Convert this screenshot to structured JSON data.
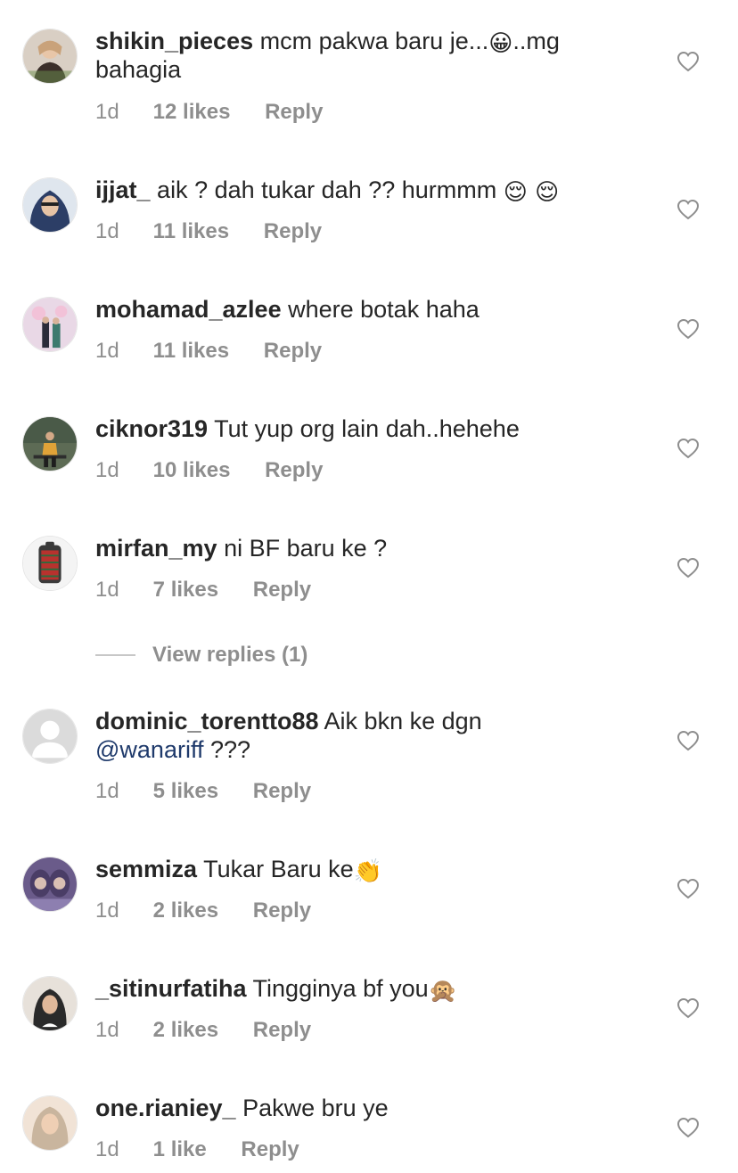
{
  "comments": [
    {
      "username": "shikin_pieces",
      "text_before": "mcm pakwa baru je...",
      "emoji": "😀",
      "text_after": "..mg bahagia",
      "time": "1d",
      "likes": "12 likes",
      "reply": "Reply"
    },
    {
      "username": "ijjat_",
      "text_before": "aik ? dah tukar dah ?? hurmmm ",
      "emoji": "😌 😌",
      "time": "1d",
      "likes": "11 likes",
      "reply": "Reply"
    },
    {
      "username": "mohamad_azlee",
      "text_before": "where botak haha",
      "time": "1d",
      "likes": "11 likes",
      "reply": "Reply"
    },
    {
      "username": "ciknor319",
      "text_before": "Tut yup org lain dah..hehehe",
      "time": "1d",
      "likes": "10 likes",
      "reply": "Reply"
    },
    {
      "username": "mirfan_my",
      "text_before": "ni BF baru ke ?",
      "time": "1d",
      "likes": "7 likes",
      "reply": "Reply"
    },
    {
      "username": "dominic_torentto88",
      "text_before": "Aik bkn ke dgn",
      "mention": "@wanariff",
      "text_after": " ???",
      "time": "1d",
      "likes": "5 likes",
      "reply": "Reply"
    },
    {
      "username": "semmiza",
      "text_before": "Tukar Baru ke",
      "emoji": "👏",
      "time": "1d",
      "likes": "2 likes",
      "reply": "Reply"
    },
    {
      "username": "_sitinurfatiha",
      "text_before": "Tingginya bf you",
      "emoji": "🙊",
      "time": "1d",
      "likes": "2 likes",
      "reply": "Reply"
    },
    {
      "username": "one.rianiey_",
      "text_before": "Pakwe bru ye",
      "time": "1d",
      "likes": "1 like",
      "reply": "Reply"
    }
  ],
  "view_replies": "View replies (1)",
  "colors": {
    "text": "#262626",
    "meta": "#8e8e8e",
    "mention": "#1f3a6b",
    "heart_stroke": "#8e8e8e"
  }
}
